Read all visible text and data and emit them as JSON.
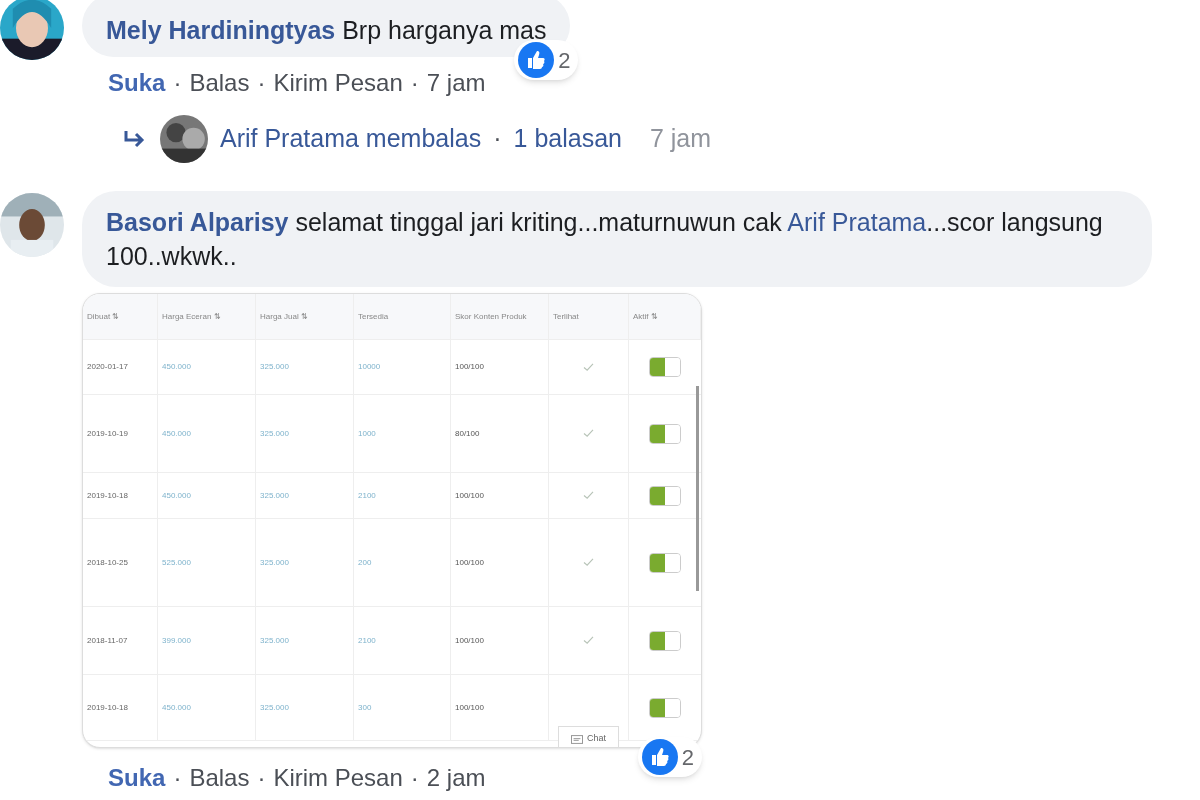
{
  "comments": [
    {
      "separator": "·",
      "author": "Mely Hardiningtyas",
      "text": "Brp harganya mas",
      "reactions": "2",
      "actions": [
        {
          "label": "Suka",
          "liked": true
        },
        {
          "label": "Balas",
          "liked": false
        },
        {
          "label": "Kirim Pesan",
          "liked": false
        }
      ],
      "time": "7 jam",
      "reply_summary": {
        "text": "Arif Pratama membalas",
        "count": "1 balasan",
        "time": "7 jam"
      }
    },
    {
      "separator": "·",
      "author": "Basori Alparisy",
      "text": "selamat tinggal jari kriting...maturnuwun cak",
      "mention": "Arif Pratama",
      "text_after": "...scor langsung 100..wkwk..",
      "reactions": "2",
      "actions": [
        {
          "label": "Suka",
          "liked": true
        },
        {
          "label": "Balas",
          "liked": false
        },
        {
          "label": "Kirim Pesan",
          "liked": false
        }
      ],
      "time": "2 jam",
      "attachment": {
        "columns": [
          "Dibuat ⇅",
          "Harga Eceran ⇅",
          "Harga Jual ⇅",
          "Tersedia",
          "Skor Konten Produk",
          "Terlihat",
          "Aktif ⇅"
        ],
        "rows": [
          {
            "date": "2020-01-17",
            "retail": "450.000",
            "price": "325.000",
            "stock": "10000",
            "score": "100/100",
            "visible": true,
            "active": true
          },
          {
            "date": "2019-10-19",
            "retail": "450.000",
            "price": "325.000",
            "stock": "1000",
            "score": "80/100",
            "visible": true,
            "active": true
          },
          {
            "date": "2019-10-18",
            "retail": "450.000",
            "price": "325.000",
            "stock": "2100",
            "score": "100/100",
            "visible": true,
            "active": true
          },
          {
            "date": "2018-10-25",
            "retail": "525.000",
            "price": "325.000",
            "stock": "200",
            "score": "100/100",
            "visible": true,
            "active": true
          },
          {
            "date": "2018-11-07",
            "retail": "399.000",
            "price": "325.000",
            "stock": "2100",
            "score": "100/100",
            "visible": true,
            "active": true
          },
          {
            "date": "2019-10-18",
            "retail": "450.000",
            "price": "325.000",
            "stock": "300",
            "score": "100/100",
            "active": true
          }
        ],
        "chat_button": "Chat"
      }
    }
  ]
}
